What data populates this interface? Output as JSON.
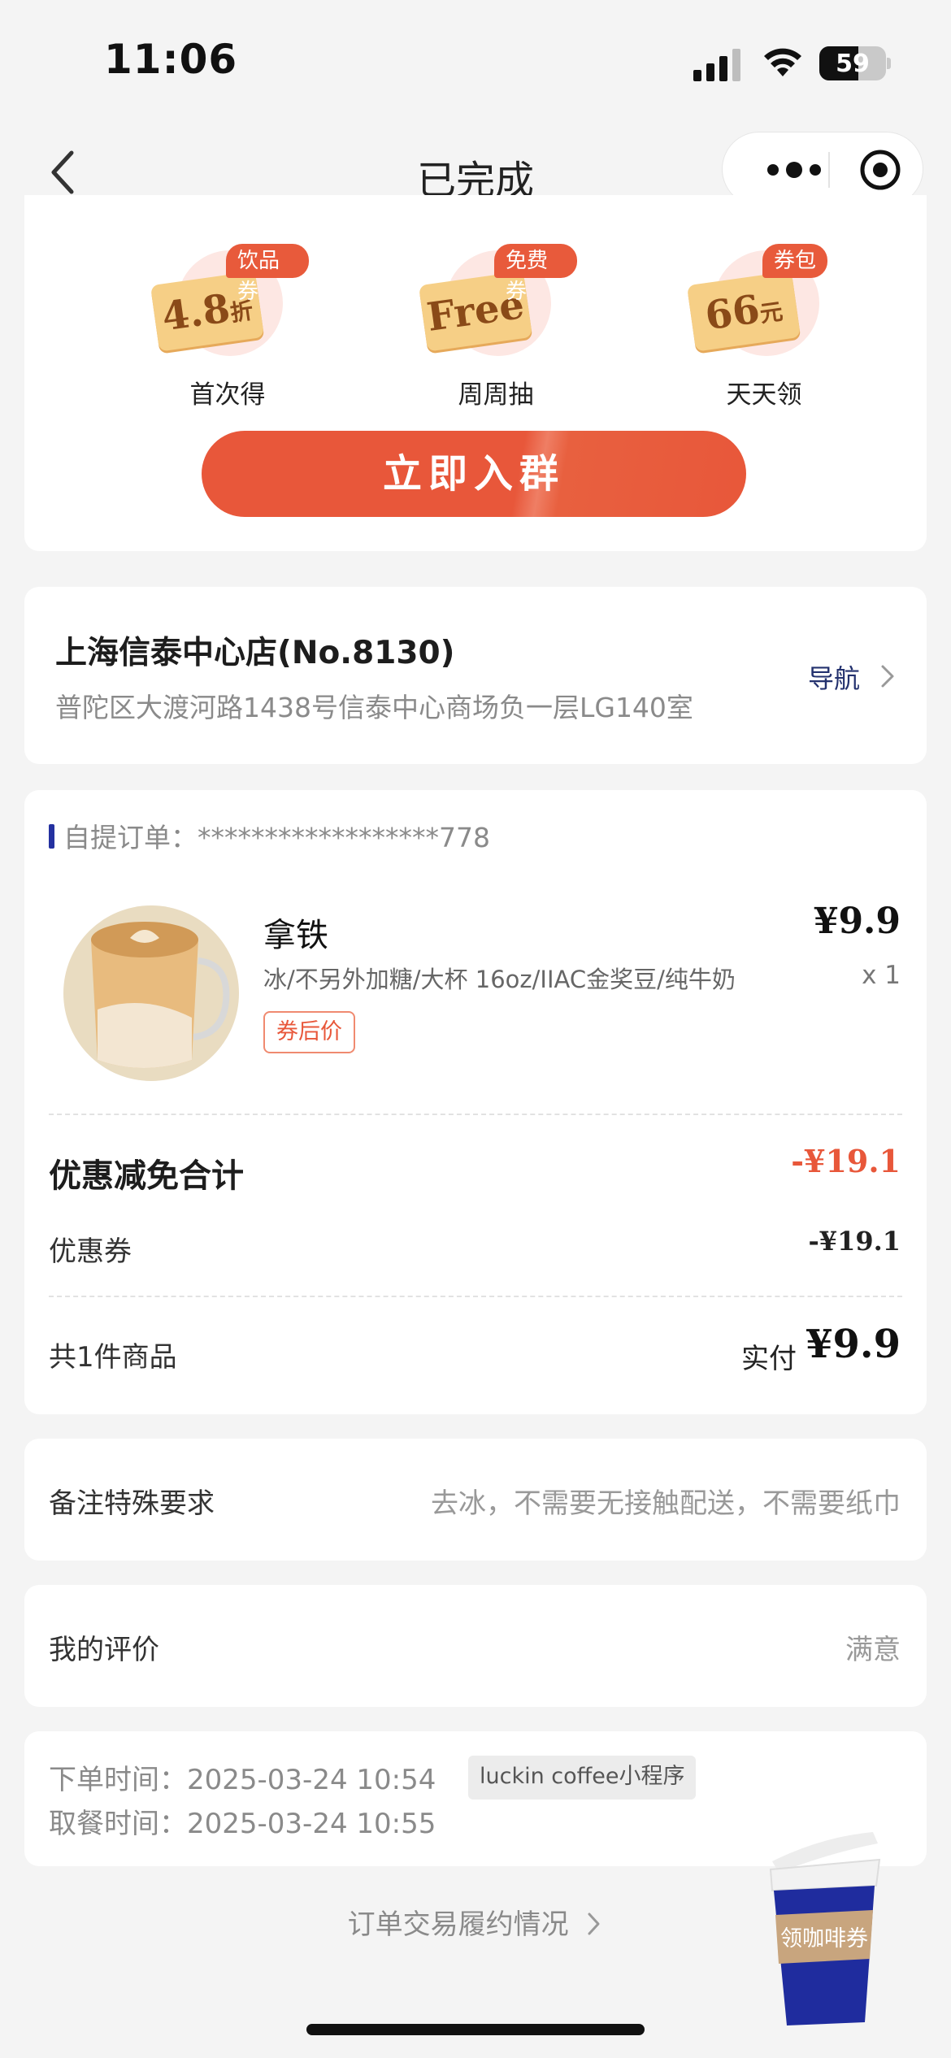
{
  "status_bar": {
    "time": "11:06",
    "battery": "59"
  },
  "nav": {
    "title": "已完成"
  },
  "promo": {
    "items": [
      {
        "tag": "饮品券",
        "value": "4.8",
        "unit": "折",
        "label": "首次得"
      },
      {
        "tag": "免费券",
        "value": "Free",
        "unit": "",
        "label": "周周抽"
      },
      {
        "tag": "券包",
        "value": "66",
        "unit": "元",
        "label": "天天领"
      }
    ],
    "join_button": "立即入群"
  },
  "store": {
    "name": "上海信泰中心店(No.8130)",
    "address": "普陀区大渡河路1438号信泰中心商场负一层LG140室",
    "nav_label": "导航"
  },
  "order": {
    "label": "自提订单：******************778",
    "product": {
      "name": "拿铁",
      "spec": "冰/不另外加糖/大杯 16oz/IIAC金奖豆/纯牛奶",
      "tag": "券后价",
      "price": "¥9.9",
      "qty": "x 1"
    },
    "discount_title": "优惠减免合计",
    "discount_total": "-¥19.1",
    "coupon_label": "优惠券",
    "coupon_value": "-¥19.1",
    "count_label": "共1件商品",
    "paid_label": "实付",
    "paid_value": "¥9.9"
  },
  "remark": {
    "label": "备注特殊要求",
    "value": "去冰，不需要无接触配送，不需要纸巾"
  },
  "review": {
    "label": "我的评价",
    "value": "满意"
  },
  "times": {
    "order_time": "下单时间：2025-03-24 10:54",
    "pickup_time": "取餐时间：2025-03-24 10:55",
    "source": "luckin coffee小程序"
  },
  "footer_link": "订单交易履约情况",
  "float_badge": "领咖啡券",
  "colors": {
    "accent": "#e8573a",
    "brand_blue": "#23316e"
  }
}
